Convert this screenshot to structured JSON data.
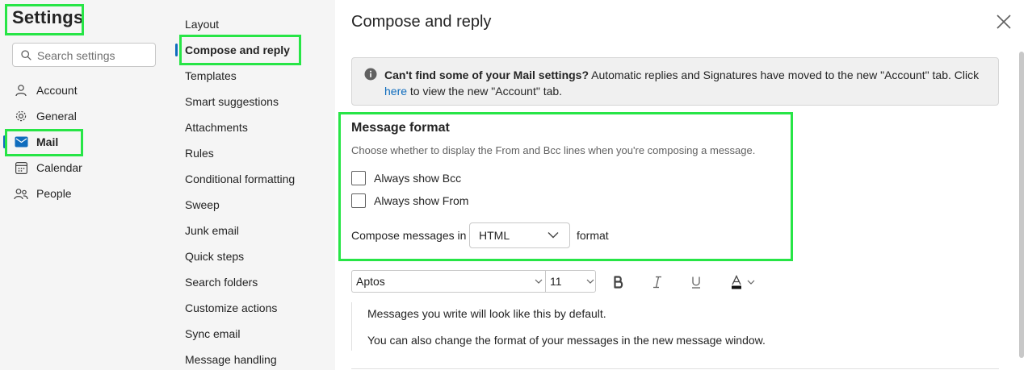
{
  "settings": {
    "title": "Settings",
    "search_placeholder": "Search settings",
    "nav": [
      {
        "label": "Account",
        "icon": "person-icon"
      },
      {
        "label": "General",
        "icon": "gear-icon"
      },
      {
        "label": "Mail",
        "icon": "mail-icon",
        "active": true
      },
      {
        "label": "Calendar",
        "icon": "calendar-icon"
      },
      {
        "label": "People",
        "icon": "people-icon"
      }
    ]
  },
  "mail_nav": [
    "Layout",
    "Compose and reply",
    "Templates",
    "Smart suggestions",
    "Attachments",
    "Rules",
    "Conditional formatting",
    "Sweep",
    "Junk email",
    "Quick steps",
    "Search folders",
    "Customize actions",
    "Sync email",
    "Message handling"
  ],
  "mail_nav_active": "Compose and reply",
  "main": {
    "title": "Compose and reply",
    "info": {
      "bold": "Can't find some of your Mail settings?",
      "text": " Automatic replies and Signatures have moved to the new \"Account\" tab. Click",
      "link": "here",
      "tail": " to view the new \"Account\" tab."
    },
    "message_format": {
      "heading": "Message format",
      "description": "Choose whether to display the From and Bcc lines when you're composing a message.",
      "always_bcc": "Always show Bcc",
      "always_from": "Always show From",
      "compose_label": "Compose messages in",
      "format_value": "HTML",
      "format_suffix": "format"
    },
    "toolbar": {
      "font": "Aptos",
      "size": "11"
    },
    "preview": {
      "line1": "Messages you write will look like this by default.",
      "line2": "You can also change the format of your messages in the new message window."
    }
  },
  "colors": {
    "accent": "#0f6cbd",
    "highlight": "#27e546"
  }
}
